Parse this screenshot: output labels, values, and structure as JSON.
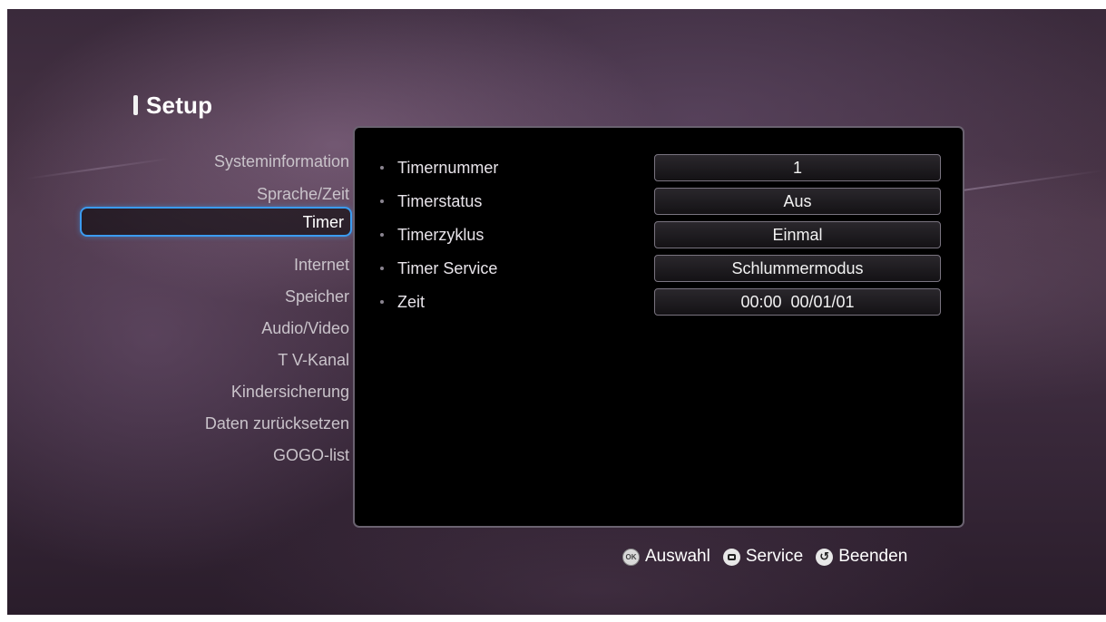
{
  "header": {
    "title": "Setup"
  },
  "sidebar": {
    "items": [
      {
        "label": "Systeminformation"
      },
      {
        "label": "Sprache/Zeit"
      },
      {
        "label": "Timer",
        "selected": true
      },
      {
        "label": "Internet"
      },
      {
        "label": "Speicher"
      },
      {
        "label": "Audio/Video"
      },
      {
        "label": "T V-Kanal"
      },
      {
        "label": "Kindersicherung"
      },
      {
        "label": "Daten zurücksetzen"
      },
      {
        "label": "GOGO-list"
      }
    ]
  },
  "settings": [
    {
      "label": "Timernummer",
      "value": "1"
    },
    {
      "label": "Timerstatus",
      "value": "Aus"
    },
    {
      "label": "Timerzyklus",
      "value": "Einmal"
    },
    {
      "label": "Timer Service",
      "value": "Schlummermodus"
    },
    {
      "label": "Zeit",
      "value": "00:00  00/01/01"
    }
  ],
  "footer": {
    "hints": [
      {
        "icon": "ok-button-icon",
        "label": "Auswahl"
      },
      {
        "icon": "service-button-icon",
        "label": "Service"
      },
      {
        "icon": "return-button-icon",
        "label": "Beenden"
      }
    ]
  },
  "colors": {
    "selection_border": "#3b9bf0",
    "panel_background": "#000000"
  }
}
